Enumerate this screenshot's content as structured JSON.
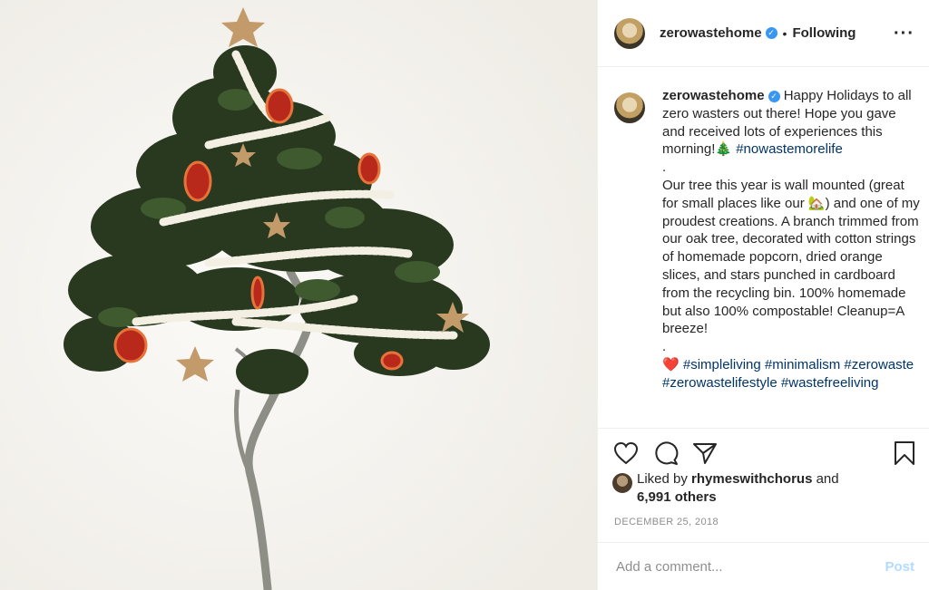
{
  "account": {
    "username": "zerowastehome",
    "verified": true,
    "separator": "•",
    "follow_status": "Following"
  },
  "caption": {
    "username": "zerowastehome",
    "intro": " Happy Holidays to all zero wasters out there! Hope you gave and received lots of experiences this morning!🎄 ",
    "intro_tag": "#nowastemorelife",
    "dot1": ".",
    "body": "Our tree this year is wall mounted (great for small places like our 🏡) and one of my proudest creations. A branch trimmed from our oak tree, decorated with cotton strings of homemade popcorn, dried orange slices, and stars punched in cardboard from the recycling bin. 100% homemade but also 100% compostable! Cleanup=A breeze!",
    "dot2": ".",
    "heart": "❤️ ",
    "tags": [
      "#simpleliving",
      "#minimalism",
      "#zerowaste",
      "#zerowastelifestyle",
      "#wastefreeliving"
    ]
  },
  "likes": {
    "prefix": "Liked by ",
    "user": "rhymeswithchorus",
    "mid": " and ",
    "others": "6,991 others"
  },
  "date": "DECEMBER 25, 2018",
  "comment": {
    "placeholder": "Add a comment...",
    "post_label": "Post"
  },
  "icons": {
    "like": "heart-icon",
    "comment": "comment-icon",
    "share": "share-icon",
    "save": "bookmark-icon",
    "more": "more-icon"
  },
  "colors": {
    "link": "#003569",
    "verified": "#3897f0",
    "post_disabled": "#b3dbff",
    "muted": "#8e8e8e"
  }
}
